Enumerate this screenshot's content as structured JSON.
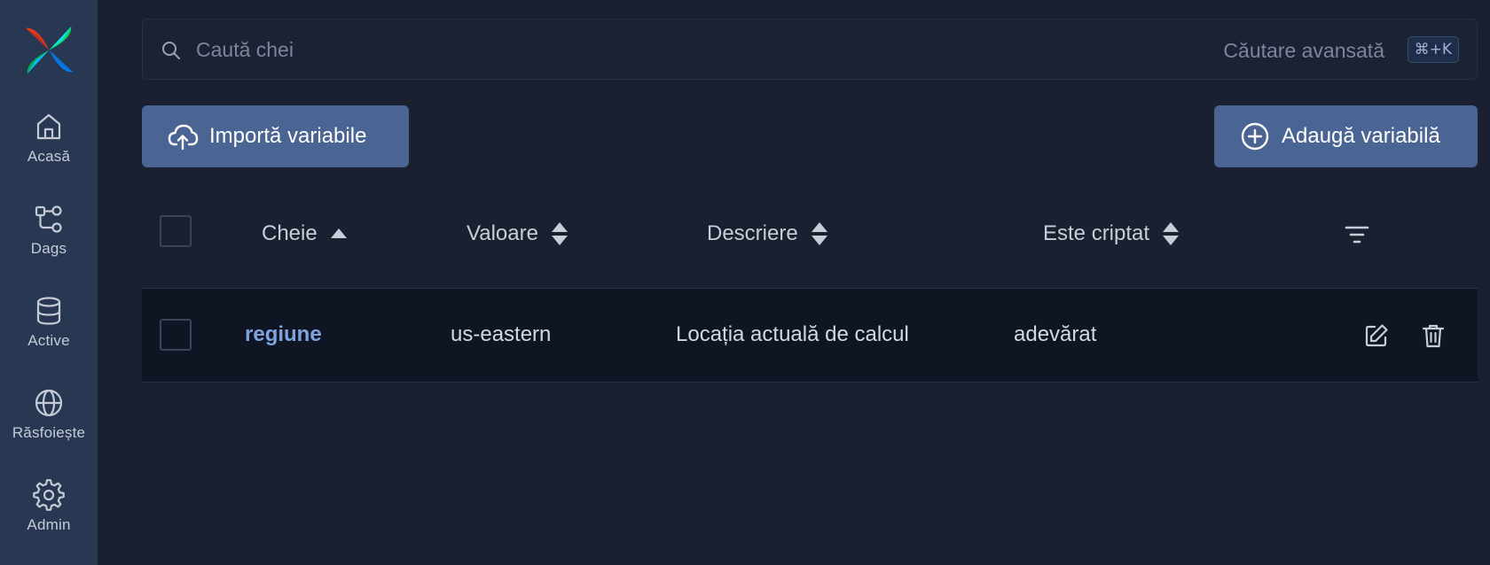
{
  "sidebar": {
    "items": [
      {
        "label": "Acasă",
        "icon": "home-icon"
      },
      {
        "label": "Dags",
        "icon": "dags-icon"
      },
      {
        "label": "Active",
        "icon": "database-icon"
      },
      {
        "label": "Răsfoiește",
        "icon": "globe-icon"
      },
      {
        "label": "Admin",
        "icon": "gear-icon"
      }
    ]
  },
  "search": {
    "placeholder": "Caută chei",
    "advanced_label": "Căutare avansată",
    "shortcut": "⌘+K"
  },
  "toolbar": {
    "import_label": "Importă variabile",
    "add_label": "Adaugă variabilă"
  },
  "table": {
    "columns": [
      {
        "label": "Cheie",
        "sort": "ascending"
      },
      {
        "label": "Valoare",
        "sort": "none"
      },
      {
        "label": "Descriere",
        "sort": "none"
      },
      {
        "label": "Este criptat",
        "sort": "none"
      }
    ],
    "rows": [
      {
        "key": "regiune",
        "value": "us-eastern",
        "description": "Locația actuală de calcul",
        "encrypted": "adevărat"
      }
    ]
  },
  "colors": {
    "background": "#1a2030",
    "sidebar": "#283752",
    "button": "#4a6594",
    "link": "#7fa4dc",
    "row": "#0f1522"
  }
}
